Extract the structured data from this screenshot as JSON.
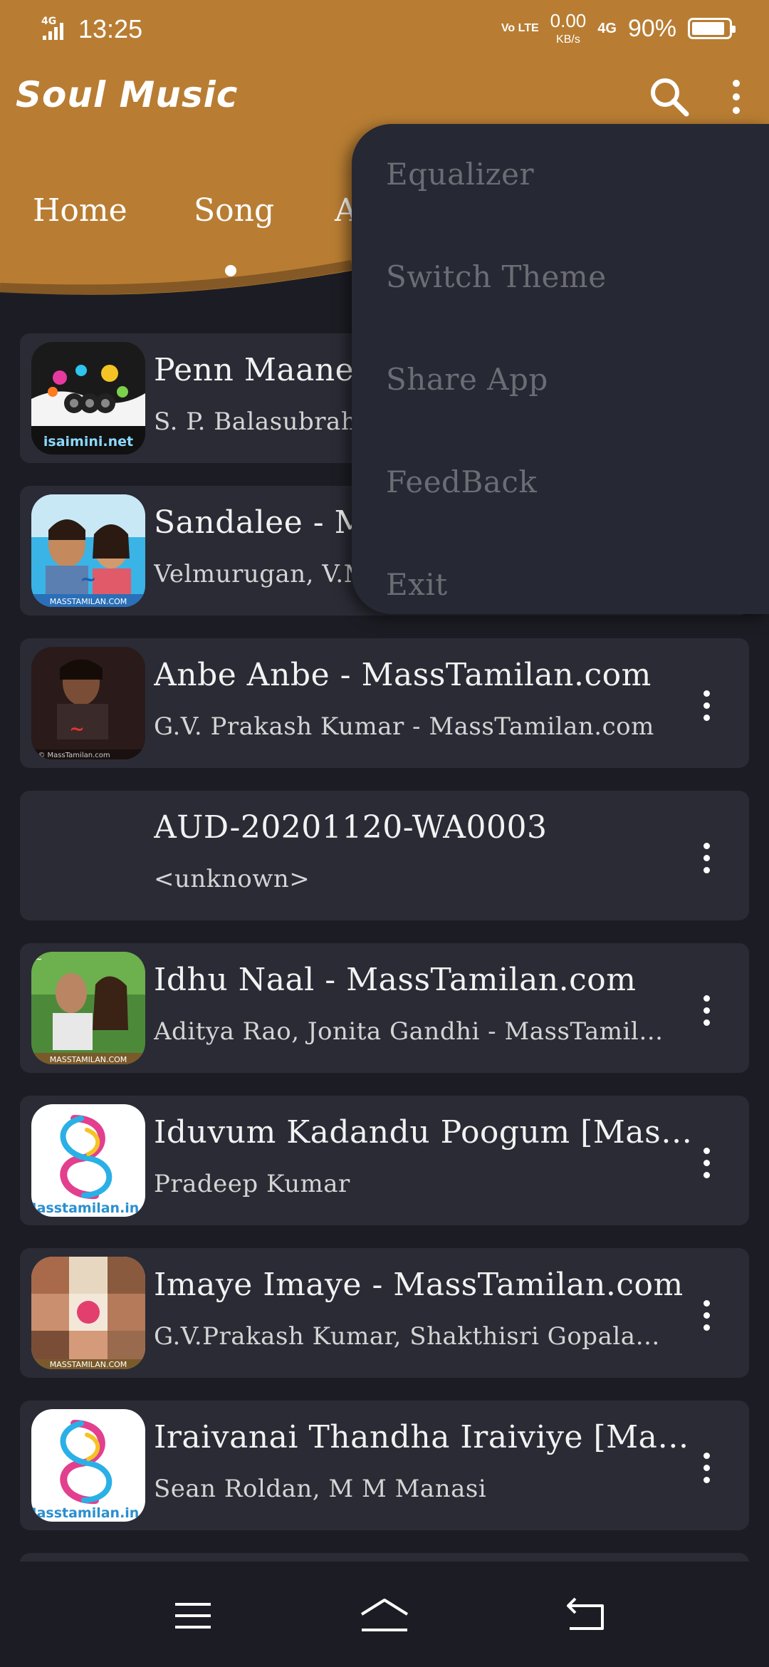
{
  "status_bar": {
    "network_left": "4G",
    "time": "13:25",
    "volte": "Vo LTE",
    "speed_value": "0.00",
    "speed_unit": "KB/s",
    "network_right": "4G",
    "battery": "90%",
    "battery_level": 0.9
  },
  "app": {
    "title": "Soul Music",
    "accent_color": "#b87d33",
    "background_color": "#1c1d24"
  },
  "toolbar": {
    "search_icon": "search-icon",
    "more_icon": "more-vertical-icon"
  },
  "tabs": [
    {
      "label": "Home"
    },
    {
      "label": "Song",
      "selected": true
    },
    {
      "label": "A"
    }
  ],
  "menu": {
    "items": [
      {
        "label": "Equalizer"
      },
      {
        "label": "Switch Theme"
      },
      {
        "label": "Share App"
      },
      {
        "label": "FeedBack"
      },
      {
        "label": "Exit"
      }
    ]
  },
  "songs": [
    {
      "title": "Penn Maaney",
      "artist": "S. P. Balasubrah",
      "thumb_text": "isaimini.net"
    },
    {
      "title": "Sandalee - Ma",
      "artist": "Velmurugan, V.M",
      "thumb_text": "MASSTAMILAN.COM"
    },
    {
      "title": "Anbe Anbe - MassTamilan.com",
      "artist": "G.V. Prakash Kumar - MassTamilan.com",
      "thumb_text": "© MassTamilan.com"
    },
    {
      "title": "AUD-20201120-WA0003",
      "artist": "<unknown>",
      "thumb_text": ""
    },
    {
      "title": "Idhu Naal - MassTamilan.com",
      "artist": "Aditya Rao, Jonita Gandhi - MassTamilan.com",
      "thumb_text": "MASSTAMILAN.COM"
    },
    {
      "title": "Iduvum Kadandu Poogum [Masstamilan.in]",
      "artist": "Pradeep Kumar",
      "thumb_text": "Masstamilan.in"
    },
    {
      "title": "Imaye Imaye - MassTamilan.com",
      "artist": "G.V.Prakash Kumar, Shakthisri Gopalan - MassTamilan.com",
      "thumb_text": "MASSTAMILAN.COM"
    },
    {
      "title": "Iraivanai Thandha Iraiviye [Masstamilan.in]",
      "artist": "Sean Roldan, M M Manasi",
      "thumb_text": "Masstamilan.in"
    }
  ],
  "navbar": {
    "menu_icon": "menu-icon",
    "home_icon": "home-icon",
    "back_icon": "back-icon"
  }
}
